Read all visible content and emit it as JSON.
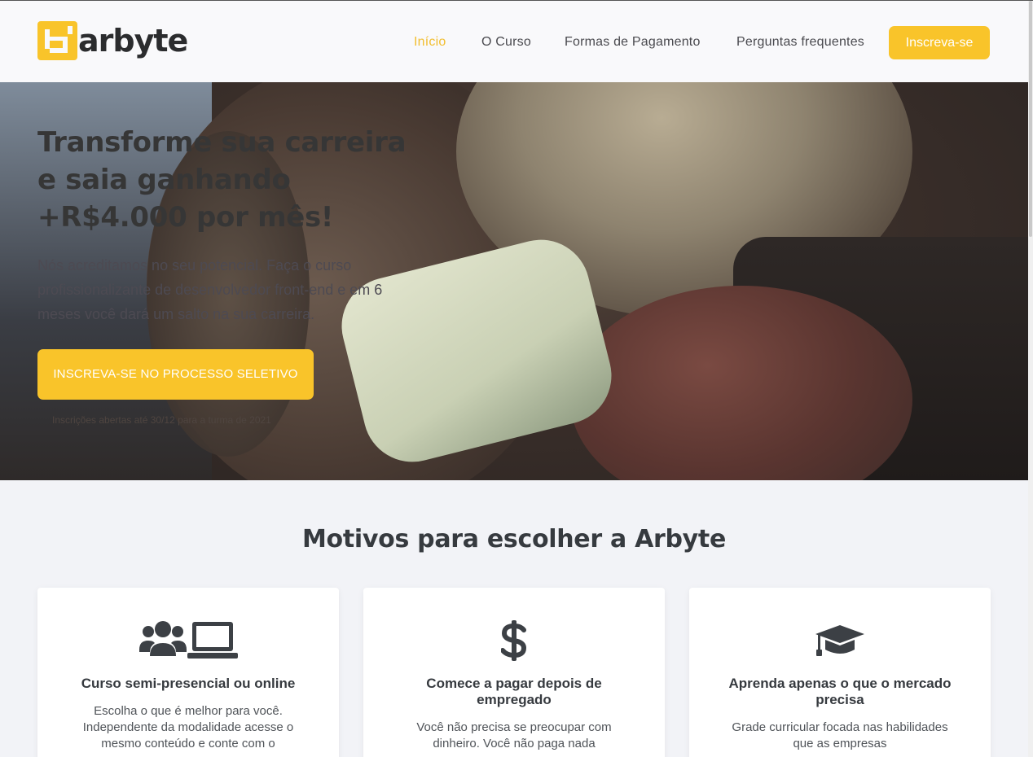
{
  "brand": {
    "name": "arbyte",
    "accent": "#f9c42a",
    "active_link": "#f2be2f"
  },
  "nav": {
    "items": [
      {
        "label": "Início",
        "active": true
      },
      {
        "label": "O Curso",
        "active": false
      },
      {
        "label": "Formas de Pagamento",
        "active": false
      },
      {
        "label": "Perguntas frequentes",
        "active": false
      }
    ],
    "cta": "Inscreva-se"
  },
  "hero": {
    "title": "Transforme sua carreira e saia ganhando +R$4.000 por mês!",
    "text": "Nós acreditamos no seu potencial. Faça o curso profissionalizante de desenvolvedor front-end e em 6 meses você dará um salto na sua carreira.",
    "cta": "INSCREVA-SE NO PROCESSO SELETIVO",
    "note": "Inscrições abertas até 30/12 para a turma de 2021"
  },
  "reasons": {
    "title": "Motivos para escolher a Arbyte",
    "cards": [
      {
        "icon": "users-laptop-icon",
        "title": "Curso semi-presencial ou online",
        "text": "Escolha o que é melhor para você. Independente da modalidade acesse o mesmo conteúdo e conte com o"
      },
      {
        "icon": "dollar-icon",
        "title": "Comece a pagar depois de empregado",
        "text": "Você não precisa se preocupar com dinheiro. Você não paga nada"
      },
      {
        "icon": "graduation-cap-icon",
        "title": "Aprenda apenas o que o mercado precisa",
        "text": "Grade curricular focada nas habilidades que as empresas"
      }
    ]
  }
}
